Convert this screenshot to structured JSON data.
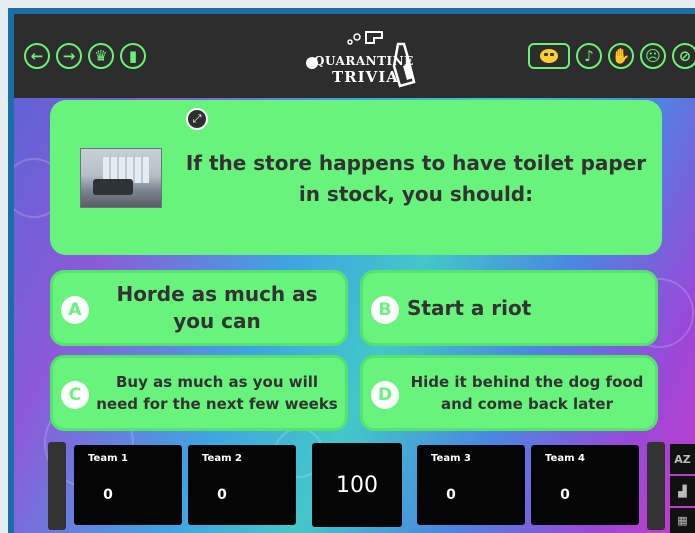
{
  "logo": {
    "line1": "QUARANTINE",
    "line2": "TRIVIA"
  },
  "toolbar_left": [
    {
      "name": "back-arrow-icon",
      "glyph": "←"
    },
    {
      "name": "forward-arrow-icon",
      "glyph": "→"
    },
    {
      "name": "trophy-icon",
      "glyph": "♛"
    },
    {
      "name": "exit-door-icon",
      "glyph": "▮"
    }
  ],
  "toolbar_right": [
    {
      "name": "music-note-icon",
      "glyph": "♪"
    },
    {
      "name": "cheer-hands-icon",
      "glyph": "✋"
    },
    {
      "name": "sad-face-icon",
      "glyph": "☹"
    },
    {
      "name": "mute-icon",
      "glyph": "⊘"
    }
  ],
  "question": {
    "text": "If the store happens to have toilet paper in stock, you should:",
    "image_icon": "truck-with-toilet-paper-photo",
    "expand_icon": "expand-icon"
  },
  "answers": [
    {
      "letter": "A",
      "text": "Horde as much as you can"
    },
    {
      "letter": "B",
      "text": "Start a riot"
    },
    {
      "letter": "C",
      "text": "Buy as much as you will need for the next few weeks"
    },
    {
      "letter": "D",
      "text": "Hide it behind the dog food and come back later"
    }
  ],
  "teams": [
    {
      "name": "Team 1",
      "score": "0"
    },
    {
      "name": "Team 2",
      "score": "0"
    },
    {
      "name": "Team 3",
      "score": "0"
    },
    {
      "name": "Team 4",
      "score": "0"
    }
  ],
  "current_points": "100",
  "side_tools": {
    "az_label": "AZ"
  },
  "colors": {
    "accent_green": "#68f37d",
    "topbar": "#2d2d2d",
    "panel": "#050505"
  }
}
